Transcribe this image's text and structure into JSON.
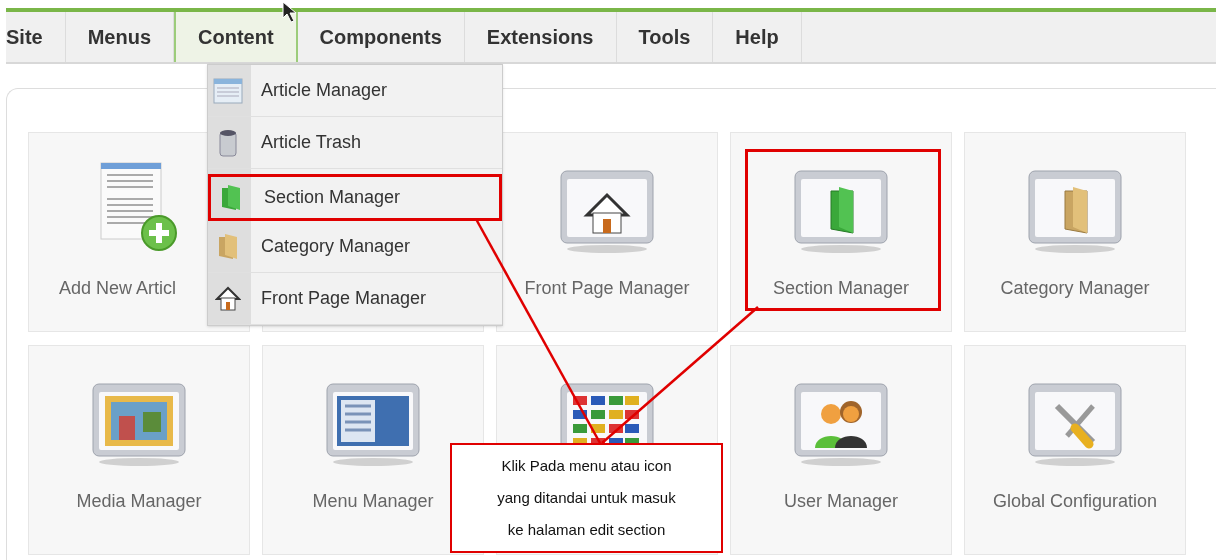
{
  "menu_bar": [
    {
      "label": "Site",
      "selected": false
    },
    {
      "label": "Menus",
      "selected": false
    },
    {
      "label": "Content",
      "selected": true
    },
    {
      "label": "Components",
      "selected": false
    },
    {
      "label": "Extensions",
      "selected": false
    },
    {
      "label": "Tools",
      "selected": false
    },
    {
      "label": "Help",
      "selected": false
    }
  ],
  "dropdown": [
    {
      "label": "Article Manager",
      "marked": false
    },
    {
      "label": "Article Trash",
      "marked": false
    },
    {
      "label": "Section Manager",
      "marked": true
    },
    {
      "label": "Category Manager",
      "marked": false
    },
    {
      "label": "Front Page Manager",
      "marked": false
    }
  ],
  "cards": [
    {
      "label": "Add New Articl",
      "marked": false
    },
    {
      "label": "Front Page Manager",
      "marked": false
    },
    {
      "label": "Section Manager",
      "marked": true
    },
    {
      "label": "Category Manager",
      "marked": false
    },
    {
      "label": "Media Manager",
      "marked": false
    },
    {
      "label": "Menu Manager",
      "marked": false
    },
    {
      "marked": false
    },
    {
      "label": "User Manager",
      "marked": false
    },
    {
      "label": "Global Configuration",
      "marked": false
    }
  ],
  "callout": {
    "text": "Klik Pada menu atau icon\nyang ditandai untuk masuk\nke halaman edit section"
  }
}
